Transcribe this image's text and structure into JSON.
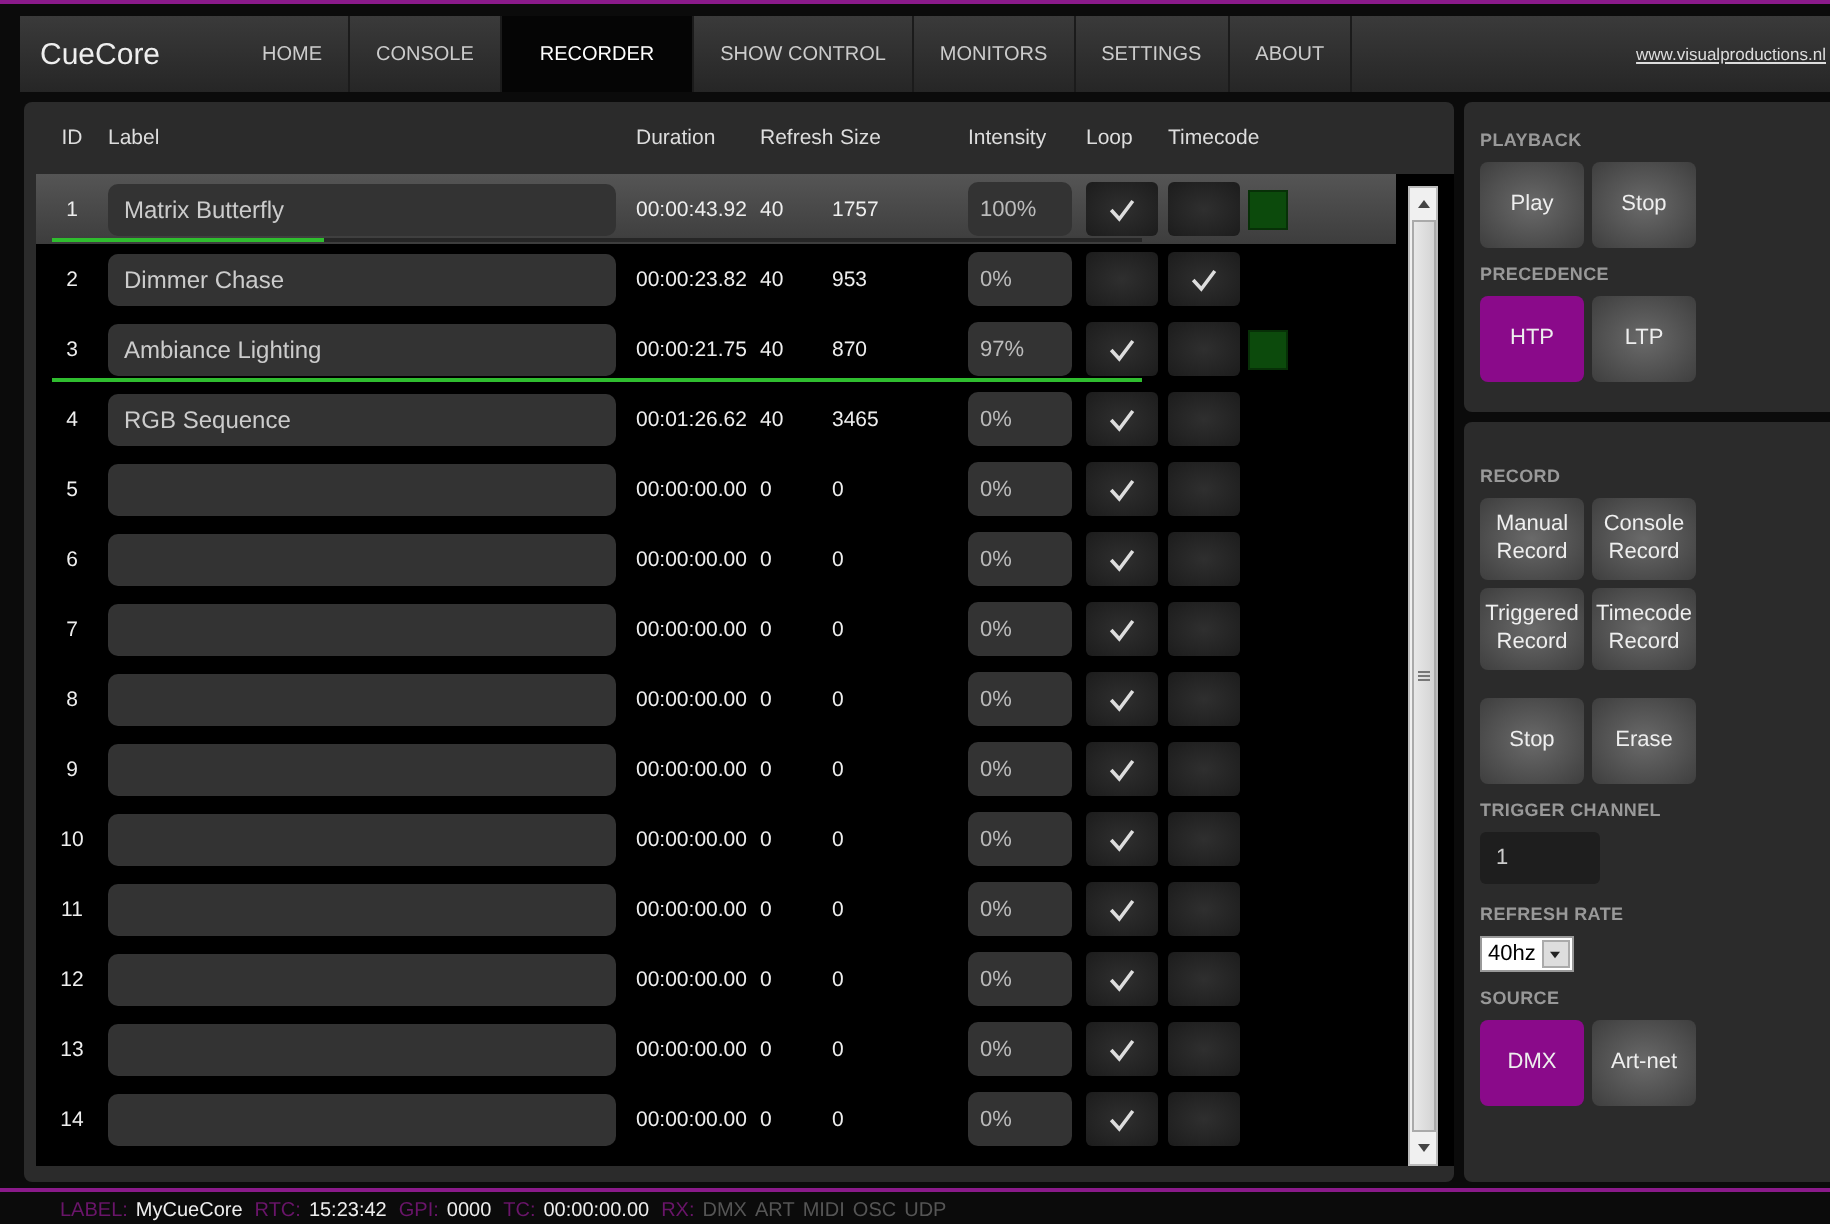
{
  "app": {
    "logo": "CueCore",
    "link": "www.visualproductions.nl"
  },
  "tabs": [
    {
      "label": "HOME",
      "selected": false
    },
    {
      "label": "CONSOLE",
      "selected": false
    },
    {
      "label": "RECORDER",
      "selected": true
    },
    {
      "label": "SHOW CONTROL",
      "selected": false
    },
    {
      "label": "MONITORS",
      "selected": false
    },
    {
      "label": "SETTINGS",
      "selected": false
    },
    {
      "label": "ABOUT",
      "selected": false
    }
  ],
  "table": {
    "columns": [
      "ID",
      "Label",
      "Duration",
      "Refresh",
      "Size",
      "Intensity",
      "Loop",
      "Timecode"
    ],
    "rows": [
      {
        "id": "1",
        "label": "Matrix Butterfly",
        "duration": "00:00:43.92",
        "refresh": "40",
        "size": "1757",
        "intensity": "100%",
        "loop": true,
        "timecode": false,
        "active": true,
        "selected": true,
        "level": 0.25
      },
      {
        "id": "2",
        "label": "Dimmer Chase",
        "duration": "00:00:23.82",
        "refresh": "40",
        "size": "953",
        "intensity": "0%",
        "loop": false,
        "timecode": true,
        "active": false,
        "selected": false
      },
      {
        "id": "3",
        "label": "Ambiance Lighting",
        "duration": "00:00:21.75",
        "refresh": "40",
        "size": "870",
        "intensity": "97%",
        "loop": true,
        "timecode": false,
        "active": true,
        "selected": false,
        "level": 1
      },
      {
        "id": "4",
        "label": "RGB Sequence",
        "duration": "00:01:26.62",
        "refresh": "40",
        "size": "3465",
        "intensity": "0%",
        "loop": true,
        "timecode": false,
        "active": false,
        "selected": false
      },
      {
        "id": "5",
        "duration": "00:00:00.00",
        "refresh": "0",
        "size": "0",
        "intensity": "0%",
        "loop": true,
        "timecode": false,
        "active": false,
        "selected": false
      },
      {
        "id": "6",
        "duration": "00:00:00.00",
        "refresh": "0",
        "size": "0",
        "intensity": "0%",
        "loop": true,
        "timecode": false,
        "active": false,
        "selected": false
      },
      {
        "id": "7",
        "duration": "00:00:00.00",
        "refresh": "0",
        "size": "0",
        "intensity": "0%",
        "loop": true,
        "timecode": false,
        "active": false,
        "selected": false
      },
      {
        "id": "8",
        "duration": "00:00:00.00",
        "refresh": "0",
        "size": "0",
        "intensity": "0%",
        "loop": true,
        "timecode": false,
        "active": false,
        "selected": false
      },
      {
        "id": "9",
        "duration": "00:00:00.00",
        "refresh": "0",
        "size": "0",
        "intensity": "0%",
        "loop": true,
        "timecode": false,
        "active": false,
        "selected": false
      },
      {
        "id": "10",
        "duration": "00:00:00.00",
        "refresh": "0",
        "size": "0",
        "intensity": "0%",
        "loop": true,
        "timecode": false,
        "active": false,
        "selected": false
      },
      {
        "id": "11",
        "duration": "00:00:00.00",
        "refresh": "0",
        "size": "0",
        "intensity": "0%",
        "loop": true,
        "timecode": false,
        "active": false,
        "selected": false
      },
      {
        "id": "12",
        "duration": "00:00:00.00",
        "refresh": "0",
        "size": "0",
        "intensity": "0%",
        "loop": true,
        "timecode": false,
        "active": false,
        "selected": false
      },
      {
        "id": "13",
        "duration": "00:00:00.00",
        "refresh": "0",
        "size": "0",
        "intensity": "0%",
        "loop": true,
        "timecode": false,
        "active": false,
        "selected": false
      },
      {
        "id": "14",
        "duration": "00:00:00.00",
        "refresh": "0",
        "size": "0",
        "intensity": "0%",
        "loop": true,
        "timecode": false,
        "active": false,
        "selected": false
      }
    ]
  },
  "playback": {
    "title": "PLAYBACK",
    "buttons": [
      {
        "label": "Play"
      },
      {
        "label": "Stop"
      }
    ]
  },
  "precedence": {
    "title": "PRECEDENCE",
    "options": [
      {
        "label": "HTP",
        "selected": true
      },
      {
        "label": "LTP",
        "selected": false
      }
    ]
  },
  "record": {
    "title": "RECORD",
    "buttons": [
      {
        "label": "Manual Record"
      },
      {
        "label": "Console Record"
      },
      {
        "label": "Triggered Record"
      },
      {
        "label": "Timecode Record"
      }
    ],
    "actions": [
      {
        "label": "Stop"
      },
      {
        "label": "Erase"
      }
    ],
    "trigger_channel": {
      "title": "TRIGGER CHANNEL",
      "value": "1"
    },
    "refresh_rate": {
      "title": "REFRESH RATE",
      "value": "40hz"
    },
    "source": {
      "title": "SOURCE",
      "options": [
        {
          "label": "DMX",
          "selected": true
        },
        {
          "label": "Art-net",
          "selected": false
        }
      ]
    }
  },
  "status_bar": {
    "items": [
      {
        "label": "LABEL:",
        "value": "MyCueCore"
      },
      {
        "label": "RTC:",
        "value": "15:23:42"
      },
      {
        "label": "GPI:",
        "value": "0000"
      },
      {
        "label": "TC:",
        "value": "00:00:00.00"
      }
    ],
    "rx": {
      "label": "RX:",
      "items": [
        {
          "text": "DMX",
          "active": false
        },
        {
          "text": "ART",
          "active": false
        },
        {
          "text": "MIDI",
          "active": false
        },
        {
          "text": "OSC",
          "active": false
        },
        {
          "text": "UDP",
          "active": false
        }
      ]
    }
  }
}
